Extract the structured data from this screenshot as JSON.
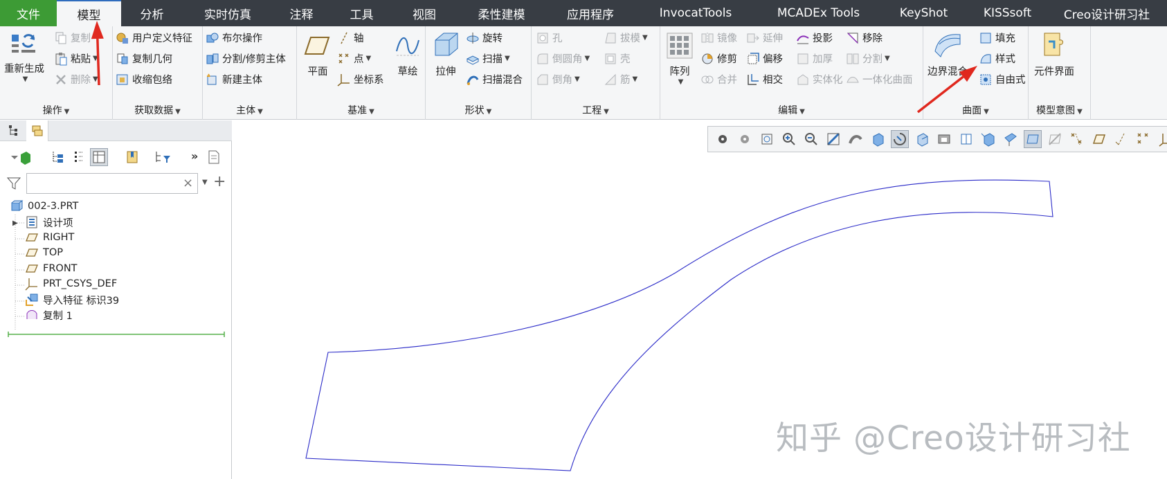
{
  "menu": {
    "tabs": [
      {
        "label": "文件",
        "w": 82
      },
      {
        "label": "模型",
        "w": 93
      },
      {
        "label": "分析",
        "w": 89
      },
      {
        "label": "实时仿真",
        "w": 130
      },
      {
        "label": "注释",
        "w": 83
      },
      {
        "label": "工具",
        "w": 91
      },
      {
        "label": "视图",
        "w": 90
      },
      {
        "label": "柔性建模",
        "w": 133
      },
      {
        "label": "应用程序",
        "w": 124
      },
      {
        "label": "InvocatTools",
        "w": 180
      },
      {
        "label": "MCADEx Tools",
        "w": 175
      },
      {
        "label": "KeyShot",
        "w": 129
      },
      {
        "label": "KISSsoft",
        "w": 113
      },
      {
        "label": "Creo设计研习社",
        "w": 174
      }
    ]
  },
  "ribbon": {
    "ops": {
      "title": "操作",
      "regenerate": "重新生成",
      "copy": "复制",
      "paste": "粘贴",
      "delete": "删除"
    },
    "getdata": {
      "title": "获取数据",
      "udf": "用户定义特征",
      "copygeom": "复制几何",
      "shrinkwrap": "收缩包络"
    },
    "body": {
      "title": "主体",
      "boolean": "布尔操作",
      "split": "分割/修剪主体",
      "newbody": "新建主体"
    },
    "datum": {
      "title": "基准",
      "plane": "平面",
      "axis": "轴",
      "point": "点",
      "csys": "坐标系",
      "sketch": "草绘"
    },
    "shapes": {
      "title": "形状",
      "extrude": "拉伸",
      "revolve": "旋转",
      "sweep": "扫描",
      "sweepblend": "扫描混合"
    },
    "engineering": {
      "title": "工程",
      "hole": "孔",
      "round": "倒圆角",
      "chamfer": "倒角",
      "draft": "拔模",
      "shell": "壳",
      "rib": "筋"
    },
    "editing": {
      "title": "编辑",
      "pattern": "阵列",
      "mirror": "镜像",
      "trim": "修剪",
      "merge": "合并",
      "extend": "延伸",
      "offset": "偏移",
      "intersect": "相交",
      "project": "投影",
      "thicken": "加厚",
      "solidify": "实体化",
      "remove": "移除",
      "split": "分割",
      "unify": "一体化曲面"
    },
    "surfaces": {
      "title": "曲面",
      "boundary": "边界混合",
      "fill": "填充",
      "style": "样式",
      "freestyle": "自由式"
    },
    "intent": {
      "title": "模型意图",
      "component": "元件界面"
    }
  },
  "tree": {
    "search_placeholder": "",
    "items": [
      {
        "label": "002-3.PRT",
        "icon": "part-icon"
      },
      {
        "label": "设计项",
        "icon": "design-items-icon"
      },
      {
        "label": "RIGHT",
        "icon": "datum-plane-icon"
      },
      {
        "label": "TOP",
        "icon": "datum-plane-icon"
      },
      {
        "label": "FRONT",
        "icon": "datum-plane-icon"
      },
      {
        "label": "PRT_CSYS_DEF",
        "icon": "csys-icon"
      },
      {
        "label": "导入特征 标识39",
        "icon": "import-feature-icon"
      },
      {
        "label": "复制 1",
        "icon": "copy-surface-icon"
      }
    ]
  },
  "graphics": {
    "watermark": "知乎 @Creo设计研习社",
    "curve_color": "#2a2ac8"
  },
  "colors": {
    "menubar": "#383d44",
    "file_tab": "#3d9b35",
    "accent": "#2d6bbd",
    "arrow": "#e0281e"
  }
}
